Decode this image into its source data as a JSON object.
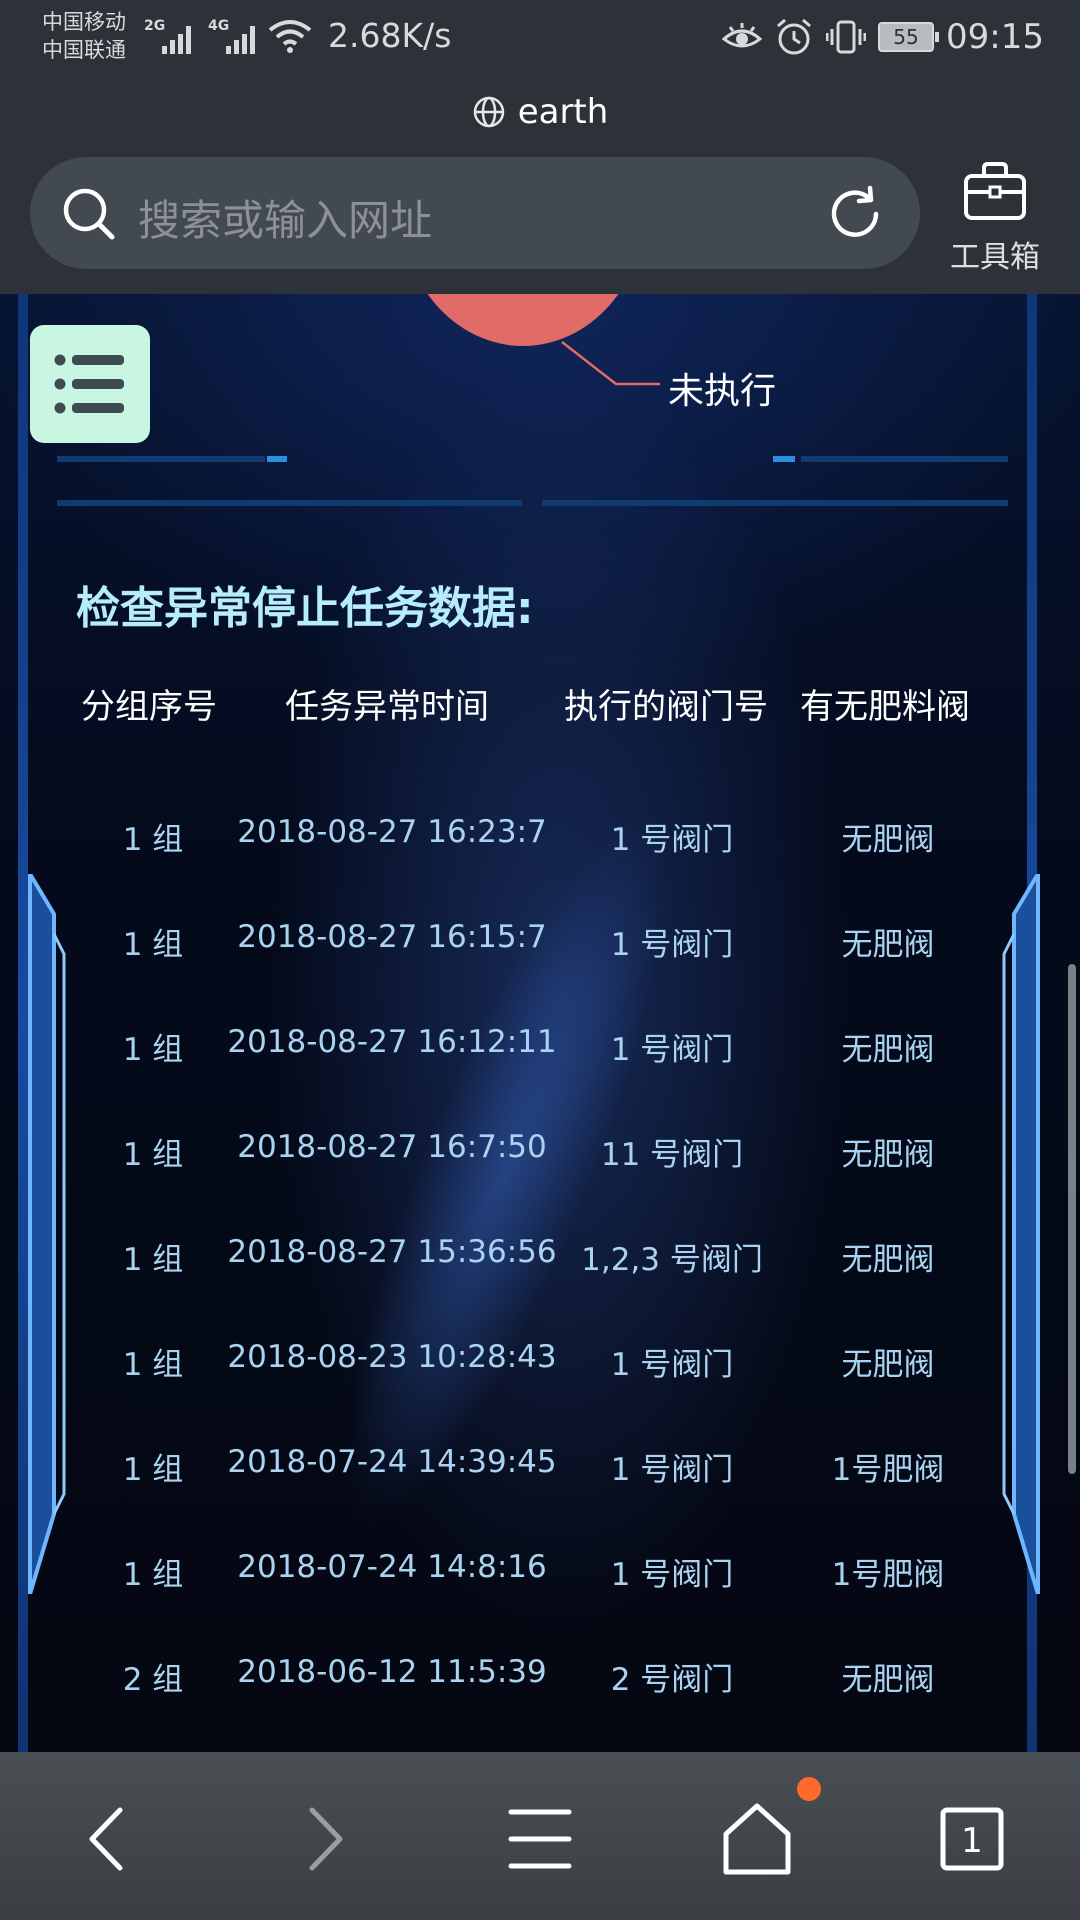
{
  "status_bar": {
    "carrier_1": "中国移动",
    "carrier_2": "中国联通",
    "signal_1_tag": "2G",
    "signal_2_tag": "4G",
    "net_speed": "2.68K/s",
    "battery": "55",
    "time": "09:15"
  },
  "browser": {
    "page_title": "earth",
    "search_placeholder": "搜索或输入网址",
    "toolbox_label": "工具箱",
    "tab_count": "1"
  },
  "chart": {
    "visible_slice_label": "未执行",
    "visible_slice_color": "#e06b67"
  },
  "section": {
    "title": "检查异常停止任务数据:"
  },
  "table": {
    "headers": [
      "分组序号",
      "任务异常时间",
      "执行的阀门号",
      "有无肥料阀"
    ],
    "rows": [
      [
        "1 组",
        "2018-08-27 16:23:7",
        "1 号阀门",
        "无肥阀"
      ],
      [
        "1 组",
        "2018-08-27 16:15:7",
        "1 号阀门",
        "无肥阀"
      ],
      [
        "1 组",
        "2018-08-27 16:12:11",
        "1 号阀门",
        "无肥阀"
      ],
      [
        "1 组",
        "2018-08-27 16:7:50",
        "11 号阀门",
        "无肥阀"
      ],
      [
        "1 组",
        "2018-08-27 15:36:56",
        "1,2,3 号阀门",
        "无肥阀"
      ],
      [
        "1 组",
        "2018-08-23 10:28:43",
        "1 号阀门",
        "无肥阀"
      ],
      [
        "1 组",
        "2018-07-24 14:39:45",
        "1 号阀门",
        "1号肥阀"
      ],
      [
        "1 组",
        "2018-07-24 14:8:16",
        "1 号阀门",
        "1号肥阀"
      ],
      [
        "2 组",
        "2018-06-12 11:5:39",
        "2 号阀门",
        "无肥阀"
      ]
    ]
  },
  "colors": {
    "chrome_bg": "#2c3238",
    "title_accent": "#b6ecfb",
    "row_text": "#a9d3f0",
    "menu_button_bg": "#c9f6e2",
    "notification_dot": "#ff6a2c"
  }
}
